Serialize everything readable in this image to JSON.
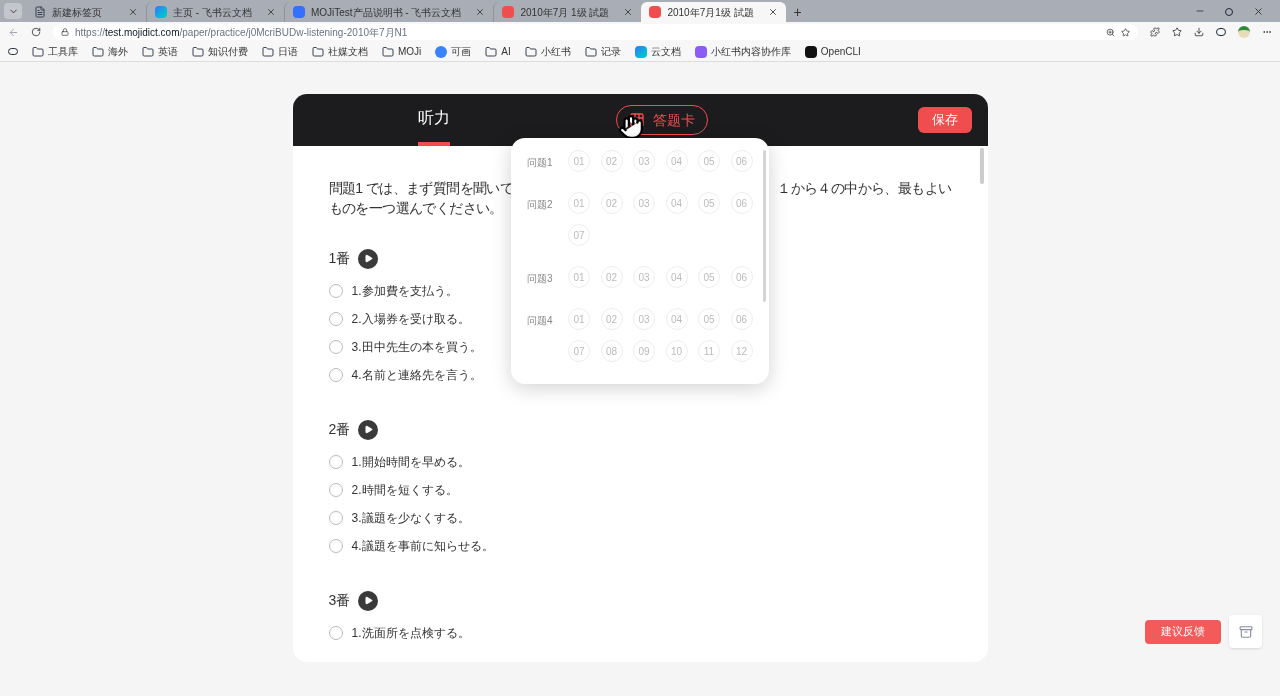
{
  "browser": {
    "tabs": [
      {
        "title": "新建标签页",
        "selected": false,
        "kind": "page"
      },
      {
        "title": "主页 - 飞书云文档",
        "selected": false,
        "kind": "bird"
      },
      {
        "title": "MOJiTest产品说明书 - 飞书云文档",
        "selected": false,
        "kind": "doc"
      },
      {
        "title": "2010年7月 1级 試題",
        "selected": false,
        "kind": "red"
      },
      {
        "title": "2010年7月1级 試題",
        "selected": true,
        "kind": "red"
      }
    ],
    "new_tab": "+",
    "url_prefix": "https://",
    "url_host": "test.mojidict.com",
    "url_path": "/paper/practice/j0McriBUDw-listening-2010年7月N1",
    "bookmarks": [
      {
        "label": "工具库",
        "kind": "folder"
      },
      {
        "label": "海外",
        "kind": "folder"
      },
      {
        "label": "英语",
        "kind": "folder"
      },
      {
        "label": "知识付费",
        "kind": "folder"
      },
      {
        "label": "日语",
        "kind": "folder"
      },
      {
        "label": "社媒文档",
        "kind": "folder"
      },
      {
        "label": "MOJi",
        "kind": "folder"
      },
      {
        "label": "可画",
        "kind": "circle"
      },
      {
        "label": "AI",
        "kind": "folder"
      },
      {
        "label": "小红书",
        "kind": "folder"
      },
      {
        "label": "记录",
        "kind": "folder"
      },
      {
        "label": "云文档",
        "kind": "bird"
      },
      {
        "label": "小红书内容协作库",
        "kind": "purple"
      },
      {
        "label": "OpenCLI",
        "kind": "terminal"
      }
    ]
  },
  "header": {
    "tabs": [
      {
        "label": "听力",
        "selected": true
      }
    ],
    "answer_card": {
      "label": "答题卡",
      "open": true
    },
    "save": "保存"
  },
  "instruction": {
    "line1_left": "問題1 では、まず質問を聞いて",
    "line1_right": "１から４の中から、最もよい",
    "line2": "ものを一つ選んでください。"
  },
  "questions": [
    {
      "label": "1番",
      "options": [
        {
          "text": "1.参加費を支払う。",
          "selected": false
        },
        {
          "text": "2.入場券を受け取る。",
          "selected": false
        },
        {
          "text": "3.田中先生の本を買う。",
          "selected": false
        },
        {
          "text": "4.名前と連絡先を言う。",
          "selected": false
        }
      ]
    },
    {
      "label": "2番",
      "options": [
        {
          "text": "1.開始時間を早める。",
          "selected": false
        },
        {
          "text": "2.時間を短くする。",
          "selected": false
        },
        {
          "text": "3.議題を少なくする。",
          "selected": false
        },
        {
          "text": "4.議題を事前に知らせる。",
          "selected": false
        }
      ]
    },
    {
      "label": "3番",
      "options": [
        {
          "text": "1.洗面所を点検する。",
          "selected": false
        }
      ]
    }
  ],
  "answer_card": [
    {
      "label": "问题1",
      "numbers": [
        "01",
        "02",
        "03",
        "04",
        "05",
        "06"
      ]
    },
    {
      "label": "问题2",
      "numbers": [
        "01",
        "02",
        "03",
        "04",
        "05",
        "06",
        "07"
      ]
    },
    {
      "label": "问题3",
      "numbers": [
        "01",
        "02",
        "03",
        "04",
        "05",
        "06"
      ]
    },
    {
      "label": "问题4",
      "numbers": [
        "01",
        "02",
        "03",
        "04",
        "05",
        "06",
        "07",
        "08",
        "09",
        "10",
        "11",
        "12"
      ]
    }
  ],
  "feedback": "建议反馈"
}
